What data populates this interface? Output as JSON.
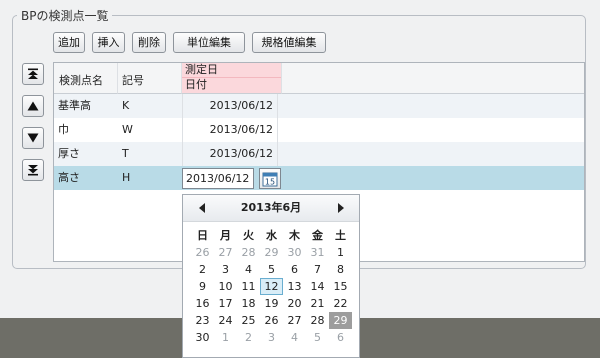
{
  "group_title": "BPの検測点一覧",
  "toolbar": {
    "add": "追加",
    "insert": "挿入",
    "delete": "削除",
    "unit_edit": "単位編集",
    "standard_edit": "規格値編集"
  },
  "grid": {
    "headers": {
      "name": "検測点名",
      "code": "記号",
      "date_top": "測定日",
      "date_bottom": "日付"
    },
    "rows": [
      {
        "name": "基準高",
        "code": "K",
        "date": "2013/06/12"
      },
      {
        "name": "巾",
        "code": "W",
        "date": "2013/06/12"
      },
      {
        "name": "厚さ",
        "code": "T",
        "date": "2013/06/12"
      },
      {
        "name": "高さ",
        "code": "H",
        "date": "2013/06/12"
      }
    ]
  },
  "date_editor": {
    "value": "2013/06/12",
    "icon_day": "15"
  },
  "calendar": {
    "title": "2013年6月",
    "weekdays": [
      "日",
      "月",
      "火",
      "水",
      "木",
      "金",
      "土"
    ],
    "weeks": [
      [
        "26",
        "27",
        "28",
        "29",
        "30",
        "31",
        "1"
      ],
      [
        "2",
        "3",
        "4",
        "5",
        "6",
        "7",
        "8"
      ],
      [
        "9",
        "10",
        "11",
        "12",
        "13",
        "14",
        "15"
      ],
      [
        "16",
        "17",
        "18",
        "19",
        "20",
        "21",
        "22"
      ],
      [
        "23",
        "24",
        "25",
        "26",
        "27",
        "28",
        "29"
      ],
      [
        "30",
        "1",
        "2",
        "3",
        "4",
        "5",
        "6"
      ]
    ],
    "today": "12",
    "selected": "29"
  }
}
